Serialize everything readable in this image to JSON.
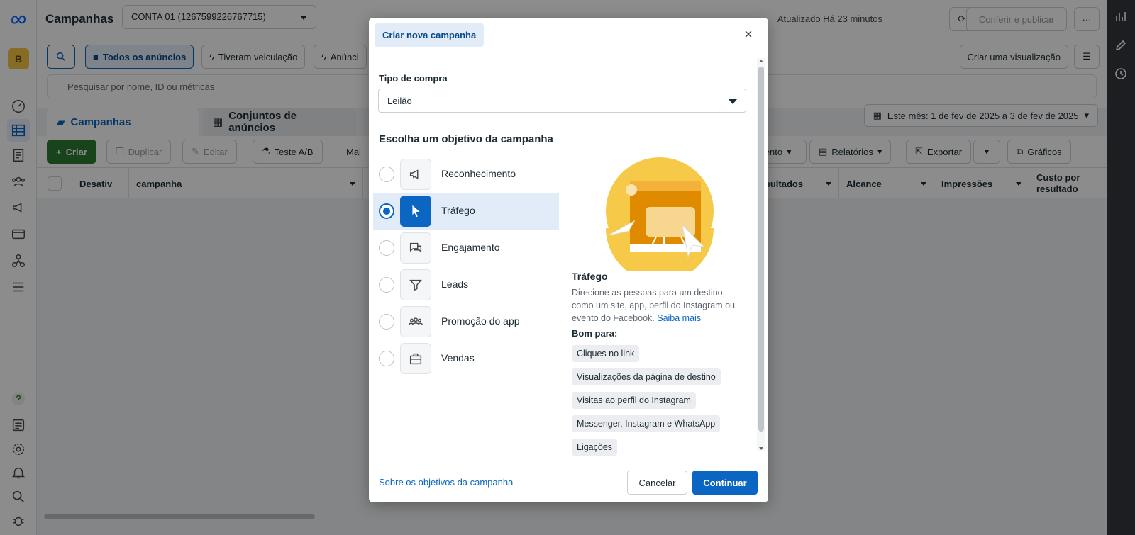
{
  "header": {
    "title": "Campanhas",
    "account": "CONTA 01 (1267599226767715)",
    "updated": "Atualizado Há 23 minutos",
    "review_publish": "Conferir e publicar",
    "more": "···"
  },
  "filters": {
    "all_ads": "Todos os anúncios",
    "had_delivery": "Tiveram veiculação",
    "ads_partial": "Anúnci",
    "create_view": "Criar uma visualização",
    "search_placeholder": "Pesquisar por nome, ID ou métricas"
  },
  "tabs": {
    "campaigns": "Campanhas",
    "ad_sets": "Conjuntos de anúncios",
    "date_range": "Este mês: 1 de fev de 2025 a 3 de fev de 2025"
  },
  "actions": {
    "create": "Criar",
    "duplicate": "Duplicar",
    "edit": "Editar",
    "ab_test": "Teste A/B",
    "more_partial": "Mai",
    "breakdown_partial": "mento",
    "reports": "Relatórios",
    "export": "Exportar",
    "charts": "Gráficos"
  },
  "table": {
    "columns": [
      "Desativ",
      "campanha",
      "Resultados",
      "Alcance",
      "Impressões",
      "Custo por resultado"
    ]
  },
  "modal": {
    "title": "Criar nova campanha",
    "purchase_type_label": "Tipo de compra",
    "purchase_type_value": "Leilão",
    "objective_heading": "Escolha um objetivo da campanha",
    "objectives": [
      {
        "label": "Reconhecimento",
        "icon": "megaphone-icon",
        "selected": false
      },
      {
        "label": "Tráfego",
        "icon": "cursor-icon",
        "selected": true
      },
      {
        "label": "Engajamento",
        "icon": "chat-bubbles-icon",
        "selected": false
      },
      {
        "label": "Leads",
        "icon": "funnel-icon",
        "selected": false
      },
      {
        "label": "Promoção do app",
        "icon": "people-icon",
        "selected": false
      },
      {
        "label": "Vendas",
        "icon": "briefcase-icon",
        "selected": false
      }
    ],
    "detail": {
      "title": "Tráfego",
      "description": "Direcione as pessoas para um destino, como um site, app, perfil do Instagram ou evento do Facebook.",
      "learn_more": "Saiba mais",
      "good_for_label": "Bom para:",
      "good_for": [
        "Cliques no link",
        "Visualizações da página de destino",
        "Visitas ao perfil do Instagram",
        "Messenger, Instagram e WhatsApp",
        "Ligações"
      ]
    },
    "footer_link": "Sobre os objetivos da campanha",
    "cancel": "Cancelar",
    "continue": "Continuar"
  },
  "colors": {
    "primary": "#0a66c2",
    "create_green": "#2e7d32",
    "illustration_yellow": "#f7c948",
    "illustration_orange": "#e08a00"
  }
}
